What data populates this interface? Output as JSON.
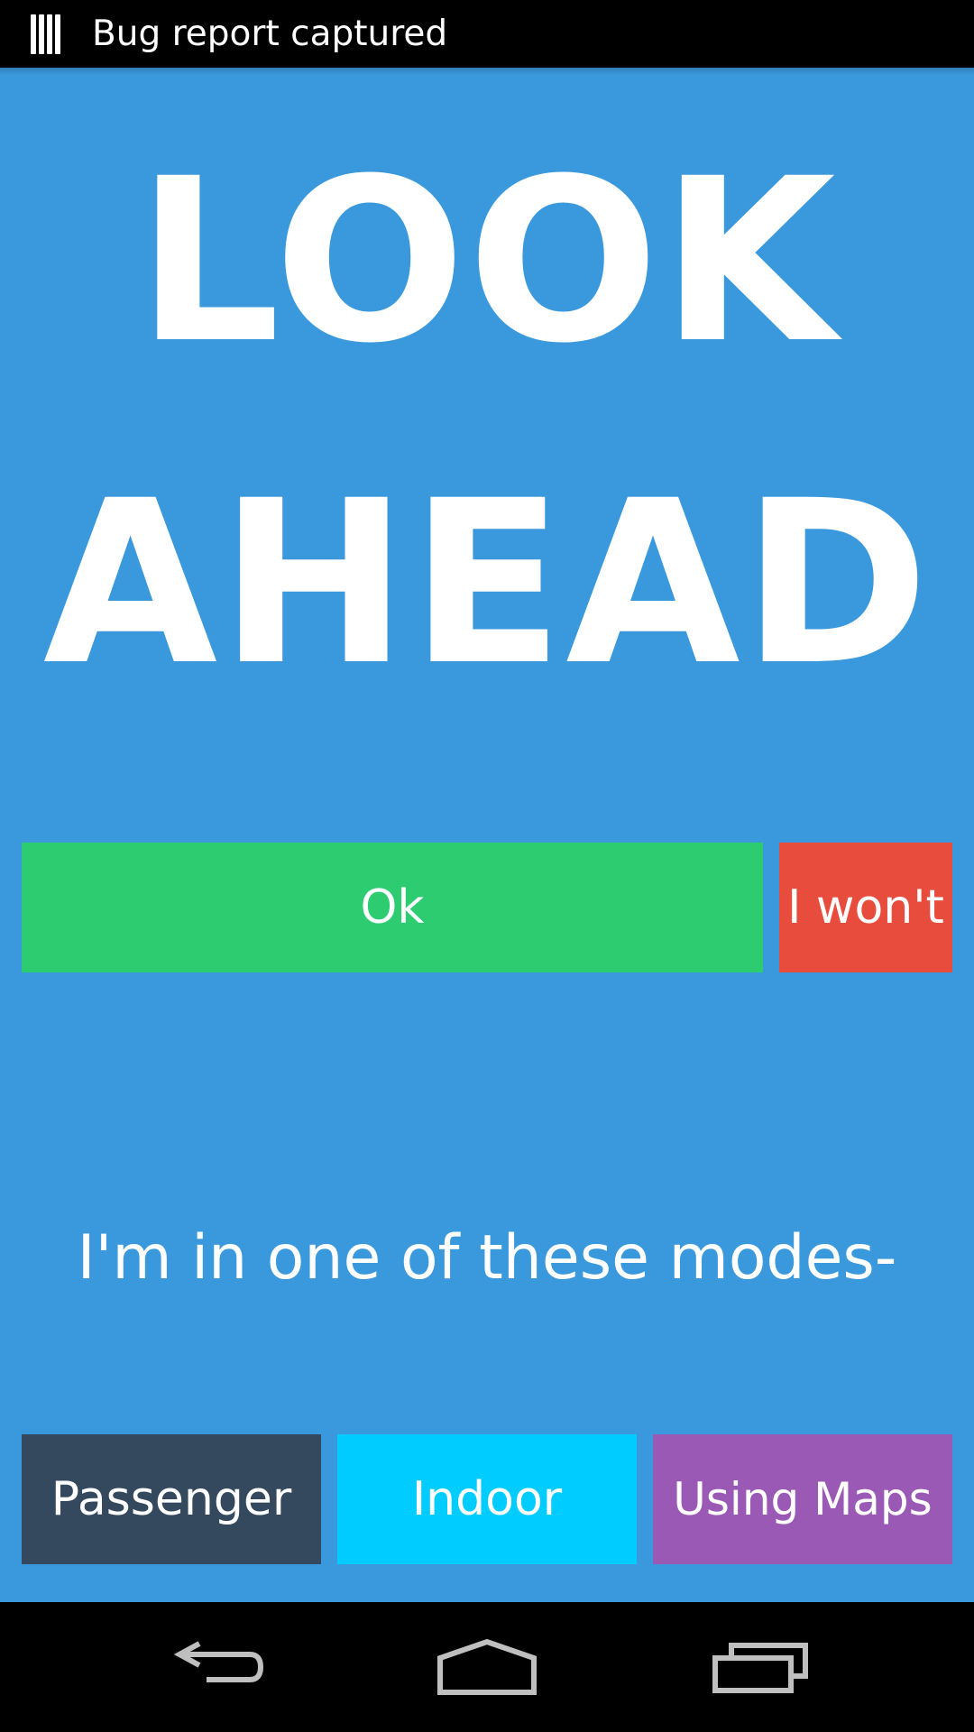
{
  "status_bar": {
    "notification_icon": "bug-report-icon",
    "text": "Bug report captured"
  },
  "headline": {
    "line1": "LOOK",
    "line2": "AHEAD"
  },
  "actions": {
    "ok_label": "Ok",
    "wont_label": "I won't"
  },
  "modes": {
    "prompt": "I'm in one of these modes-",
    "passenger_label": "Passenger",
    "indoor_label": "Indoor",
    "maps_label": "Using Maps"
  },
  "nav_bar": {
    "back_icon": "back-icon",
    "home_icon": "home-icon",
    "recents_icon": "recents-icon"
  },
  "colors": {
    "background": "#3a99dc",
    "ok": "#2ecc71",
    "wont": "#e74c3c",
    "passenger": "#34495e",
    "indoor": "#00ccff",
    "maps": "#9b59b6"
  }
}
